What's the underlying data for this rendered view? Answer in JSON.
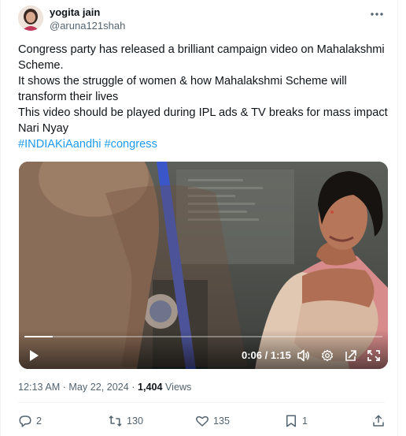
{
  "author": {
    "display_name": "yogita jain",
    "handle": "@aruna121shah"
  },
  "icons": {
    "more": "more-horizontal-icon",
    "reply": "reply-icon",
    "retweet": "retweet-icon",
    "like": "heart-icon",
    "bookmark": "bookmark-icon",
    "share": "share-icon",
    "play": "play-icon",
    "volume": "volume-icon",
    "settings": "gear-icon",
    "external": "open-external-icon",
    "fullscreen": "fullscreen-icon"
  },
  "tweet": {
    "lines": [
      "Congress party has released a brilliant campaign video on Mahalakshmi",
      "Scheme.",
      "It shows the struggle of women & how Mahalakshmi Scheme will",
      "transform their lives",
      "This video should be played during IPL ads & TV breaks for mass impact",
      "Nari Nyay"
    ],
    "hashtags": [
      "#INDIAKiAandhi",
      "#congress"
    ]
  },
  "video": {
    "current_time": "0:06",
    "duration": "1:15",
    "progress_fraction": 0.08
  },
  "meta": {
    "time": "12:13 AM",
    "separator": "·",
    "date": "May 22, 2024",
    "views_count": "1,404",
    "views_label": "Views"
  },
  "stats": {
    "replies": "2",
    "retweets": "130",
    "likes": "135",
    "bookmarks": "1"
  },
  "colors": {
    "accent": "#1d9bf0",
    "secondary_text": "#536471",
    "primary_text": "#0f1419"
  }
}
